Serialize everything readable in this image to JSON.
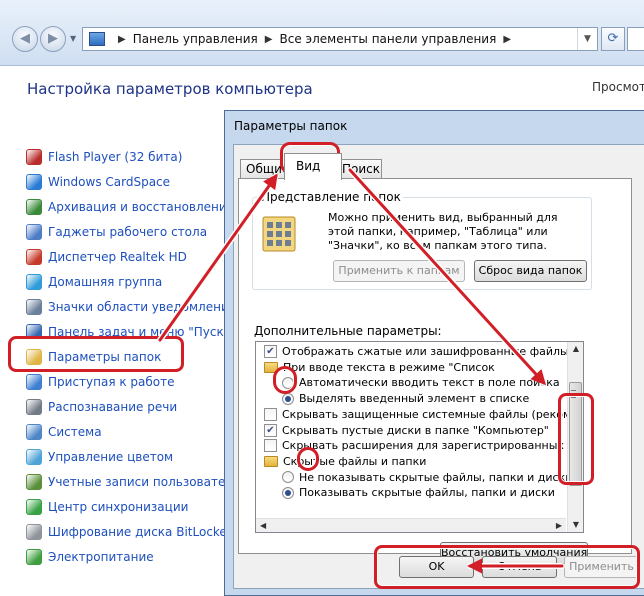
{
  "explorer": {
    "back_label": "◀",
    "forward_label": "▶",
    "breadcrumbs": [
      "Панель управления",
      "Все элементы панели управления"
    ],
    "heading": "Настройка параметров компьютера",
    "view_by_label": "Просмот"
  },
  "control_panel_items": [
    {
      "label": "Flash Player (32 бита)",
      "icon": "flash-icon",
      "color": "#b82c2c"
    },
    {
      "label": "Windows CardSpace",
      "icon": "cardspace-icon",
      "color": "#2a7bd5"
    },
    {
      "label": "Архивация и восстановление",
      "icon": "backup-icon",
      "color": "#3a8a3a"
    },
    {
      "label": "Гаджеты рабочего стола",
      "icon": "gadgets-icon",
      "color": "#4f7cc7"
    },
    {
      "label": "Диспетчер Realtek HD",
      "icon": "realtek-icon",
      "color": "#c53b2b"
    },
    {
      "label": "Домашняя группа",
      "icon": "homegroup-icon",
      "color": "#2f9bd8"
    },
    {
      "label": "Значки области уведомлений",
      "icon": "notification-icons-icon",
      "color": "#6a7f99"
    },
    {
      "label": "Панель задач и меню \"Пуск\"",
      "icon": "taskbar-icon",
      "color": "#3566b0"
    },
    {
      "label": "Параметры папок",
      "icon": "folder-options-icon",
      "color": "#e0b546"
    },
    {
      "label": "Приступая к работе",
      "icon": "getting-started-icon",
      "color": "#3f7fd1"
    },
    {
      "label": "Распознавание речи",
      "icon": "speech-icon",
      "color": "#737b86"
    },
    {
      "label": "Система",
      "icon": "system-icon",
      "color": "#4f86c7"
    },
    {
      "label": "Управление цветом",
      "icon": "color-icon",
      "color": "#4ea4d6"
    },
    {
      "label": "Учетные записи пользователей",
      "icon": "users-icon",
      "color": "#5b8f3a"
    },
    {
      "label": "Центр синхронизации",
      "icon": "sync-icon",
      "color": "#37a144"
    },
    {
      "label": "Шифрование диска BitLocker",
      "icon": "bitlocker-icon",
      "color": "#8f949b"
    },
    {
      "label": "Электропитание",
      "icon": "power-icon",
      "color": "#3f9e3f"
    }
  ],
  "dialog": {
    "title": "Параметры папок",
    "tabs": [
      "Общие",
      "Вид",
      "Поиск"
    ],
    "folder_views": {
      "legend": "Представление папок",
      "description": "Можно применить вид, выбранный для этой папки, например, \"Таблица\" или \"Значки\", ко всем папкам этого типа.",
      "apply_button": "Применить к папкам",
      "reset_button": "Сброс вида папок"
    },
    "advanced_label": "Дополнительные параметры:",
    "advanced_items": [
      {
        "kind": "checkbox",
        "checked": true,
        "label": "Отображать сжатые или зашифрованные файлы NTFS"
      },
      {
        "kind": "folder",
        "label": "При вводе текста в режиме \"Список"
      },
      {
        "kind": "radio",
        "checked": false,
        "label": "Автоматически вводить текст в поле поиска"
      },
      {
        "kind": "radio",
        "checked": true,
        "label": "Выделять введенный элемент в списке"
      },
      {
        "kind": "checkbox",
        "checked": false,
        "label": "Скрывать защищенные системные файлы (рекомендуется)"
      },
      {
        "kind": "checkbox",
        "checked": true,
        "label": "Скрывать пустые диски в папке \"Компьютер\""
      },
      {
        "kind": "checkbox",
        "checked": false,
        "label": "Скрывать расширения для зарегистрированных типов файлов"
      },
      {
        "kind": "folder",
        "label": "Скрытые файлы и папки"
      },
      {
        "kind": "radio",
        "checked": false,
        "label": "Не показывать скрытые файлы, папки и диски"
      },
      {
        "kind": "radio",
        "checked": true,
        "label": "Показывать скрытые файлы, папки и диски"
      }
    ],
    "restore_button": "Восстановить умолчания",
    "ok_button": "OK",
    "cancel_button": "Отмена",
    "apply_button": "Применить"
  },
  "annotation_color": "#d21f27"
}
